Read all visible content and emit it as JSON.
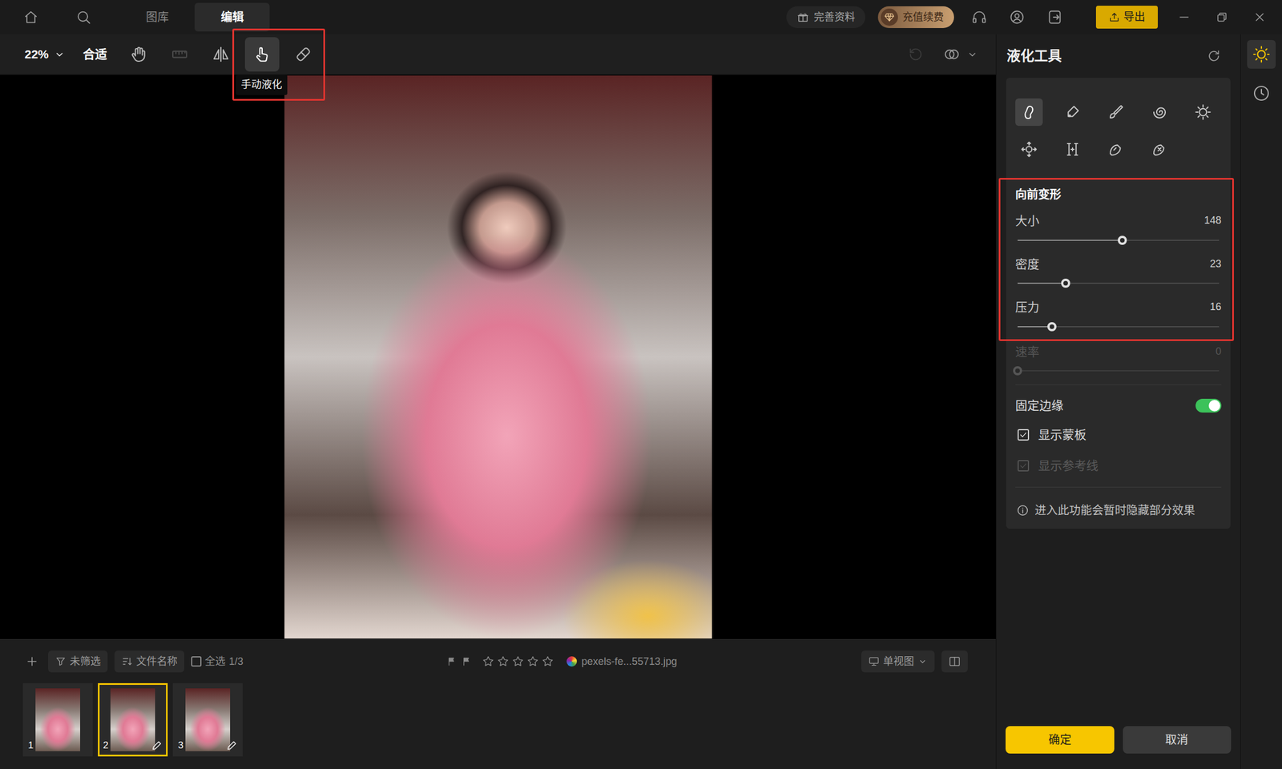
{
  "topbar": {
    "tabs": [
      {
        "label": "图库",
        "selected": false
      },
      {
        "label": "编辑",
        "selected": true
      }
    ],
    "profile": "完善资料",
    "recharge": "充值续费",
    "export": "导出"
  },
  "toolbar": {
    "zoom": "22%",
    "fit": "合适",
    "tools": [
      {
        "selected": false,
        "disabled": false
      },
      {
        "selected": false,
        "disabled": true
      },
      {
        "selected": false,
        "disabled": false
      },
      {
        "selected": true,
        "disabled": false
      },
      {
        "selected": false,
        "disabled": false
      }
    ],
    "tooltip": "手动液化",
    "undo_disabled": true
  },
  "filmstrip": {
    "filter": "未筛选",
    "sort": "文件名称",
    "select_all": {
      "label": "全选",
      "checked": false
    },
    "count": "1/3",
    "stars": 0,
    "filename": "pexels-fe...55713.jpg",
    "view": "单视图",
    "thumbnails": [
      {
        "number": "1",
        "selected": false,
        "edited": false
      },
      {
        "number": "2",
        "selected": true,
        "edited": true
      },
      {
        "number": "3",
        "selected": false,
        "edited": true
      }
    ]
  },
  "panel": {
    "title": "液化工具",
    "tools": [
      {
        "selected": true
      },
      {
        "selected": false
      },
      {
        "selected": false
      },
      {
        "selected": false
      },
      {
        "selected": false
      },
      {
        "selected": false
      },
      {
        "selected": false
      },
      {
        "selected": false
      },
      {
        "selected": false
      }
    ],
    "section": "向前变形",
    "sliders": [
      {
        "label": "大小",
        "reading": "148",
        "level": 0.52,
        "disabled": false
      },
      {
        "label": "密度",
        "reading": "23",
        "level": 0.24,
        "disabled": false
      },
      {
        "label": "压力",
        "reading": "16",
        "level": 0.17,
        "disabled": false
      },
      {
        "label": "速率",
        "reading": "0",
        "level": 0,
        "disabled": true
      }
    ],
    "fixed_edge": {
      "label": "固定边缘",
      "on": true
    },
    "options": [
      {
        "label": "显示蒙板",
        "checked": true,
        "disabled": false
      },
      {
        "label": "显示参考线",
        "checked": true,
        "disabled": true
      }
    ],
    "note": "进入此功能会暂时隐藏部分效果",
    "buttons": [
      {
        "label": "确定",
        "primary": true
      },
      {
        "label": "取消",
        "primary": false
      }
    ]
  },
  "side_strip": [
    {
      "selected": true
    },
    {
      "selected": false
    }
  ]
}
